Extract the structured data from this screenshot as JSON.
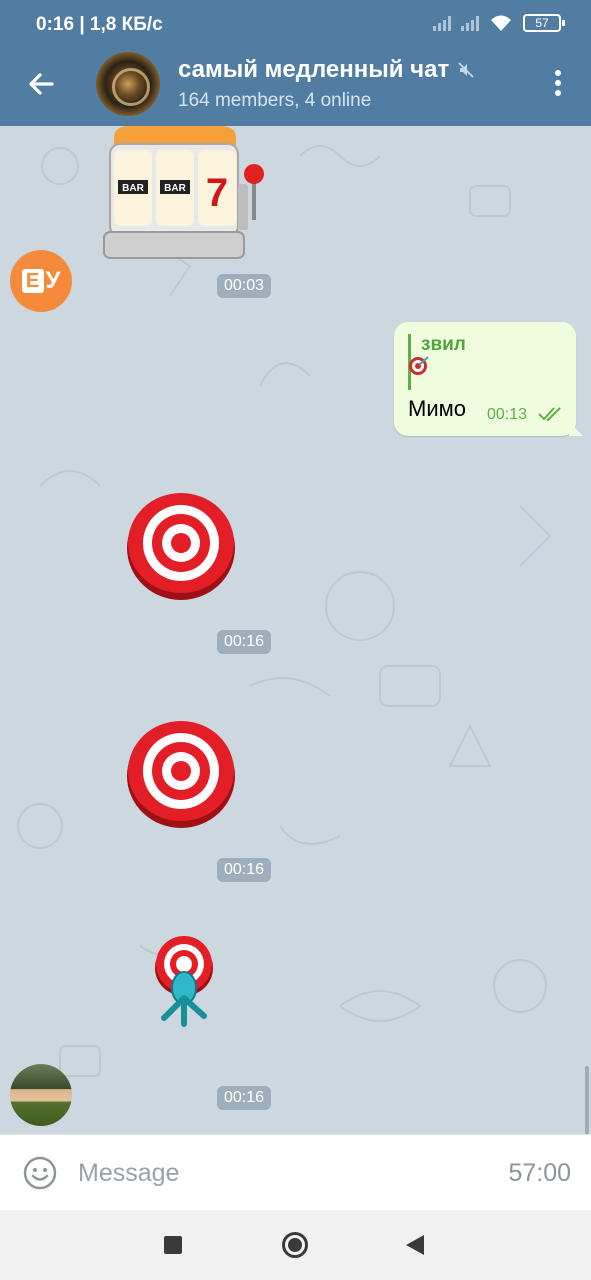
{
  "status_bar": {
    "time": "0:16",
    "network_speed": "| 1,8 КБ/с",
    "battery": "57"
  },
  "header": {
    "title": "самый медленный чат",
    "subtitle": "164 members, 4 online",
    "muted": true
  },
  "messages": [
    {
      "type": "sticker",
      "sticker": "slot-machine",
      "time": "00:03",
      "sender_avatar": "ЕУ"
    },
    {
      "type": "text",
      "outgoing": true,
      "reply_to_name": "звил",
      "reply_preview": "dart-emoji",
      "text": "Мимо",
      "time": "00:13",
      "status": "read"
    },
    {
      "type": "sticker",
      "sticker": "dart-target",
      "time": "00:16"
    },
    {
      "type": "sticker",
      "sticker": "dart-target",
      "time": "00:16"
    },
    {
      "type": "sticker",
      "sticker": "dart-target-hit",
      "time": "00:16"
    }
  ],
  "avatars": {
    "ey_letters": "У",
    "ey_box": "Е"
  },
  "input": {
    "placeholder": "Message",
    "counter": "57:00"
  },
  "colors": {
    "header": "#517da2",
    "chat_bg": "#cdd7df",
    "outgoing_bubble": "#effdde",
    "accent_green": "#4ea53a",
    "avatar_orange": "#f58a3c"
  }
}
